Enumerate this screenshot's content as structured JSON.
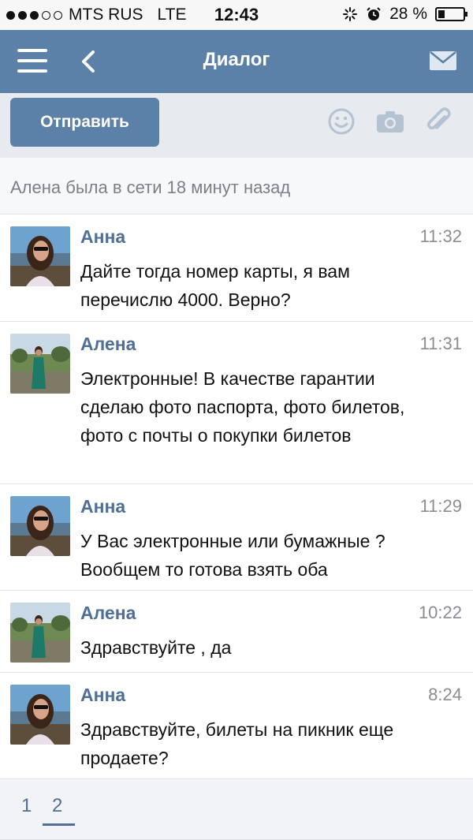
{
  "status_bar": {
    "carrier": "MTS RUS",
    "network": "LTE",
    "time": "12:43",
    "battery": "28 %"
  },
  "navbar": {
    "title": "Диалог"
  },
  "toolbar": {
    "send_label": "Отправить"
  },
  "online_status": "Алена была в сети 18 минут назад",
  "messages": [
    {
      "sender": "Анна",
      "time": "11:32",
      "text": "Дайте тогда номер карты, я вам перечислю 4000. Верно?"
    },
    {
      "sender": "Алена",
      "time": "11:31",
      "text": "Электронные! В качестве гарантии сделаю фото паспорта, фото билетов, фото с почты о покупки билетов"
    },
    {
      "sender": "Анна",
      "time": "11:29",
      "text": "У Вас электронные или бумажные ? Вообщем то готова взять оба"
    },
    {
      "sender": "Алена",
      "time": "10:22",
      "text": "Здравствуйте , да"
    },
    {
      "sender": "Анна",
      "time": "8:24",
      "text": "Здравствуйте, билеты на пикник еще продаете?"
    }
  ],
  "pagination": {
    "pages": [
      "1",
      "2"
    ],
    "active": "2"
  },
  "colors": {
    "nav_blue": "#5b81a8",
    "name_blue": "#4f6f97"
  },
  "icons": [
    "menu-icon",
    "back-arrow-icon",
    "mail-icon",
    "smiley-icon",
    "camera-icon",
    "paperclip-icon",
    "alarm-icon",
    "loading-icon"
  ]
}
